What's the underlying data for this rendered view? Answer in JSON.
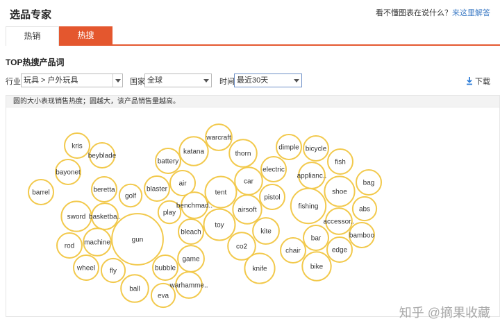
{
  "header": {
    "title": "选品专家",
    "help_prefix": "看不懂图表在说什么？",
    "help_link": "来这里解答"
  },
  "tabs": [
    {
      "label": "热销",
      "active": false
    },
    {
      "label": "热搜",
      "active": true
    }
  ],
  "section_title": "TOP热搜产品词",
  "filters": {
    "industry_label": "行业",
    "industry_value": "玩具 > 户外玩具",
    "country_label": "国家",
    "country_value": "全球",
    "time_label": "时间",
    "time_value": "最近30天",
    "download_label": "下载"
  },
  "chart_note": "圆的大小表现销售热度；圆越大，该产品销售量越高。",
  "colors": {
    "accent": "#e4572e",
    "bubble_stroke": "#f2c94c",
    "link": "#3a79c4"
  },
  "chart_data": {
    "type": "bubble",
    "bubbles": [
      {
        "label": "kris",
        "size": 1.0
      },
      {
        "label": "beyblade",
        "size": 1.0
      },
      {
        "label": "bayonet",
        "size": 1.0
      },
      {
        "label": "barrel",
        "size": 1.0
      },
      {
        "label": "beretta",
        "size": 1.0
      },
      {
        "label": "golf",
        "size": 0.9
      },
      {
        "label": "sword",
        "size": 1.2
      },
      {
        "label": "basketba..",
        "size": 1.05
      },
      {
        "label": "machine",
        "size": 1.1
      },
      {
        "label": "rod",
        "size": 1.0
      },
      {
        "label": "gun",
        "size": 2.05
      },
      {
        "label": "wheel",
        "size": 1.0
      },
      {
        "label": "fly",
        "size": 0.95
      },
      {
        "label": "ball",
        "size": 1.1
      },
      {
        "label": "eva",
        "size": 0.95
      },
      {
        "label": "bubble",
        "size": 1.0
      },
      {
        "label": "warhamme..",
        "size": 1.05
      },
      {
        "label": "game",
        "size": 1.05
      },
      {
        "label": "bleach",
        "size": 1.0
      },
      {
        "label": "play",
        "size": 0.9
      },
      {
        "label": "blaster",
        "size": 1.0
      },
      {
        "label": "air",
        "size": 1.0
      },
      {
        "label": "battery",
        "size": 1.0
      },
      {
        "label": "katana",
        "size": 1.15
      },
      {
        "label": "warcraft",
        "size": 1.05
      },
      {
        "label": "thorn",
        "size": 1.1
      },
      {
        "label": "benchmad..",
        "size": 1.05
      },
      {
        "label": "tent",
        "size": 1.25
      },
      {
        "label": "toy",
        "size": 1.25
      },
      {
        "label": "car",
        "size": 1.1
      },
      {
        "label": "airsoft",
        "size": 1.15
      },
      {
        "label": "electric",
        "size": 1.0
      },
      {
        "label": "pistol",
        "size": 1.0
      },
      {
        "label": "kite",
        "size": 1.05
      },
      {
        "label": "co2",
        "size": 1.1
      },
      {
        "label": "knife",
        "size": 1.2
      },
      {
        "label": "dimple",
        "size": 1.0
      },
      {
        "label": "bicycle",
        "size": 1.0
      },
      {
        "label": "fish",
        "size": 1.0
      },
      {
        "label": "applianc..",
        "size": 1.05
      },
      {
        "label": "shoe",
        "size": 1.2
      },
      {
        "label": "bag",
        "size": 1.0
      },
      {
        "label": "fishing",
        "size": 1.4
      },
      {
        "label": "abs",
        "size": 0.95
      },
      {
        "label": "accessor..",
        "size": 1.05
      },
      {
        "label": "bamboo",
        "size": 1.0
      },
      {
        "label": "bar",
        "size": 1.0
      },
      {
        "label": "chair",
        "size": 1.0
      },
      {
        "label": "edge",
        "size": 1.0
      },
      {
        "label": "bike",
        "size": 1.15
      }
    ]
  },
  "watermark": "知乎 @摘果收藏"
}
